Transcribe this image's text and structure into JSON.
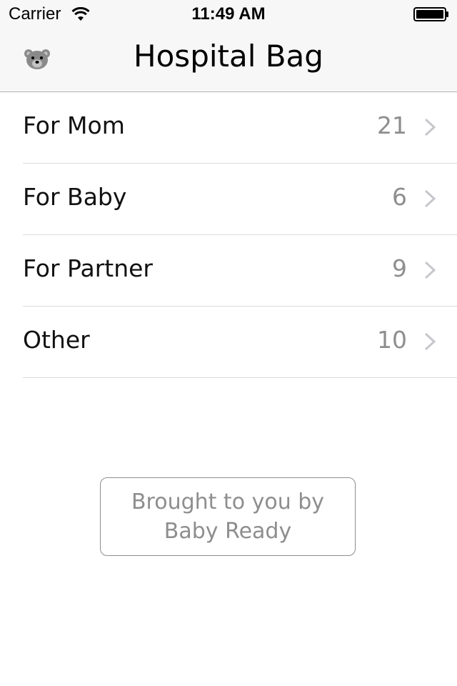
{
  "status_bar": {
    "carrier": "Carrier",
    "time": "11:49 AM",
    "wifi_icon": "wifi-icon",
    "battery_icon": "battery-icon"
  },
  "nav_bar": {
    "title": "Hospital Bag",
    "left_icon": "teddy-bear-icon"
  },
  "list": {
    "items": [
      {
        "label": "For Mom",
        "count": "21"
      },
      {
        "label": "For Baby",
        "count": "6"
      },
      {
        "label": "For Partner",
        "count": "9"
      },
      {
        "label": "Other",
        "count": "10"
      }
    ]
  },
  "credit": {
    "line1": "Brought to you by",
    "line2": "Baby Ready"
  },
  "colors": {
    "nav_background": "#f7f7f7",
    "secondary_text": "#8e8e8e",
    "separator": "#dcdcdc"
  }
}
